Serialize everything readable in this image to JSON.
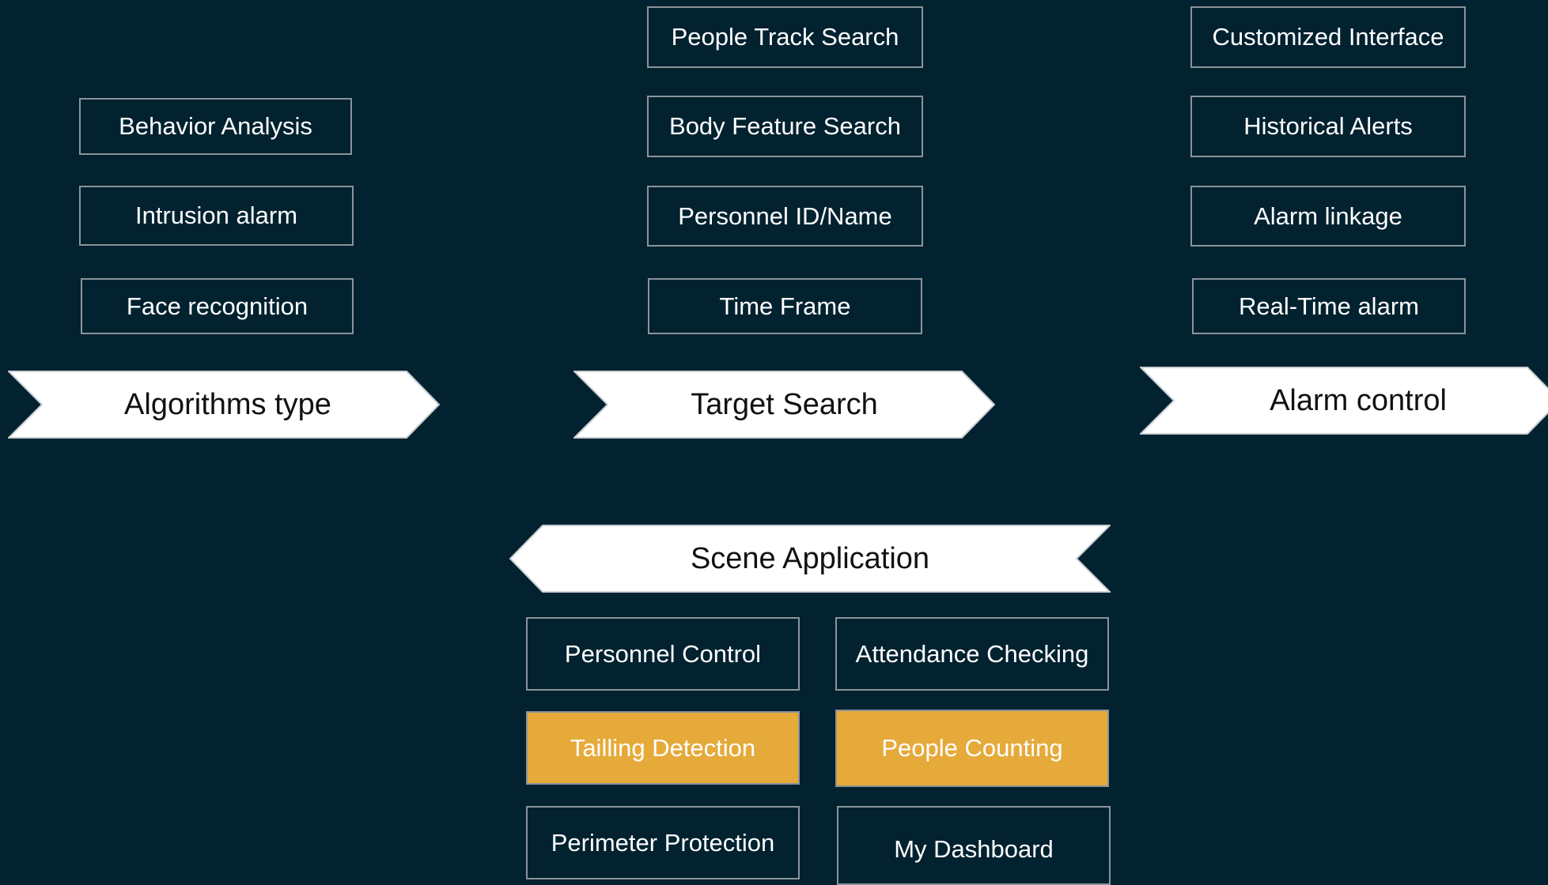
{
  "colors": {
    "background": "#022230",
    "box_border": "#8a9499",
    "highlight": "#e6aa3a",
    "chevron_fill": "#ffffff"
  },
  "algorithms": {
    "label": "Algorithms type",
    "items": [
      "Behavior Analysis",
      "Intrusion alarm",
      "Face recognition"
    ]
  },
  "target_search": {
    "label": "Target Search",
    "items": [
      "People Track Search",
      "Body Feature Search",
      "Personnel ID/Name",
      "Time Frame"
    ]
  },
  "alarm_control": {
    "label": "Alarm control",
    "items": [
      "Customized Interface",
      "Historical Alerts",
      "Alarm linkage",
      "Real-Time alarm"
    ]
  },
  "scene_application": {
    "label": "Scene Application",
    "items": [
      "Personnel Control",
      "Attendance Checking",
      "Tailling Detection",
      "People Counting",
      "Perimeter Protection",
      "My Dashboard"
    ]
  }
}
